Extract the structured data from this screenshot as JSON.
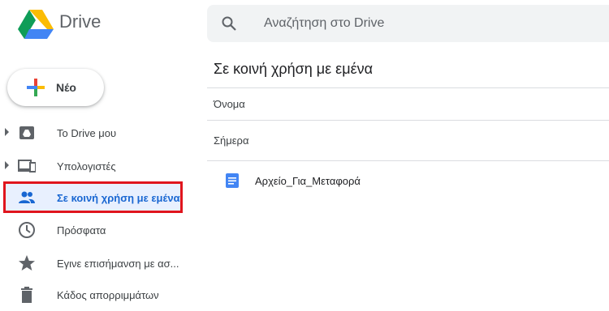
{
  "app": {
    "title": "Drive"
  },
  "search": {
    "placeholder": "Αναζήτηση στο Drive"
  },
  "new_button": {
    "label": "Νέο"
  },
  "sidebar": {
    "items": [
      {
        "label": "Το Drive μου",
        "icon": "drive-icon",
        "expandable": true,
        "active": false
      },
      {
        "label": "Υπολογιστές",
        "icon": "computers-icon",
        "expandable": true,
        "active": false
      },
      {
        "label": "Σε κοινή χρήση με εμένα",
        "icon": "people-icon",
        "expandable": false,
        "active": true
      },
      {
        "label": "Πρόσφατα",
        "icon": "clock-icon",
        "expandable": false,
        "active": false
      },
      {
        "label": "Εγινε επισήμανση με ασ...",
        "icon": "star-icon",
        "expandable": false,
        "active": false
      },
      {
        "label": "Κάδος απορριμμάτων",
        "icon": "trash-icon",
        "expandable": false,
        "active": false
      }
    ]
  },
  "main": {
    "title": "Σε κοινή χρήση με εμένα",
    "column_header": "Όνομα",
    "section": "Σήμερα",
    "files": [
      {
        "name": "Αρχείο_Για_Μεταφορά",
        "icon": "google-doc-icon"
      }
    ]
  },
  "colors": {
    "accent": "#1967d2",
    "highlight_border": "#e0151d",
    "search_bg": "#f1f3f4",
    "doc_blue": "#4285f4"
  }
}
